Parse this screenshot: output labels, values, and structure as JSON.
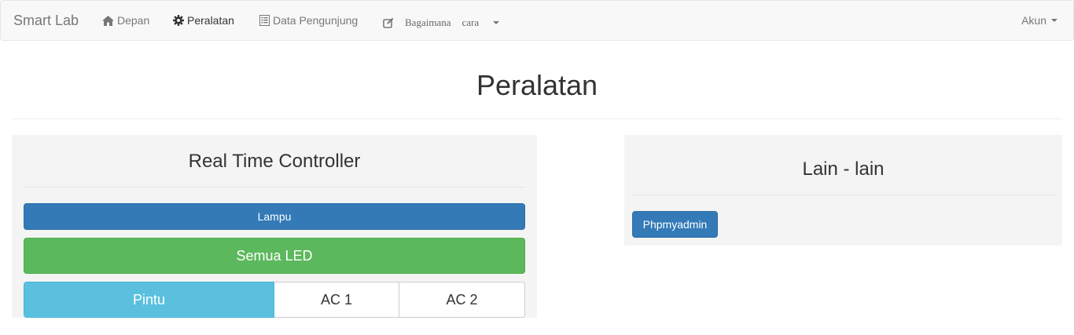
{
  "navbar": {
    "brand": "Smart Lab",
    "items": [
      {
        "label": "Depan",
        "icon": "home-icon"
      },
      {
        "label": "Peralatan",
        "icon": "cog-icon",
        "active": true
      },
      {
        "label": "Data Pengunjung",
        "icon": "list-alt-icon"
      }
    ],
    "how_to": {
      "icon": "edit-icon",
      "word1": "Bagaimana",
      "word2": "cara"
    },
    "account": "Akun"
  },
  "page": {
    "title": "Peralatan"
  },
  "controller_panel": {
    "title": "Real Time Controller",
    "lampu_label": "Lampu",
    "led_label": "Semua LED",
    "segments": [
      "Pintu",
      "AC 1",
      "AC 2"
    ]
  },
  "other_panel": {
    "title": "Lain - lain",
    "phpmyadmin_label": "Phpmyadmin"
  },
  "colors": {
    "primary": "#337ab7",
    "success": "#5cb85c",
    "info": "#5bc0de",
    "panel_bg": "#f4f4f4"
  }
}
